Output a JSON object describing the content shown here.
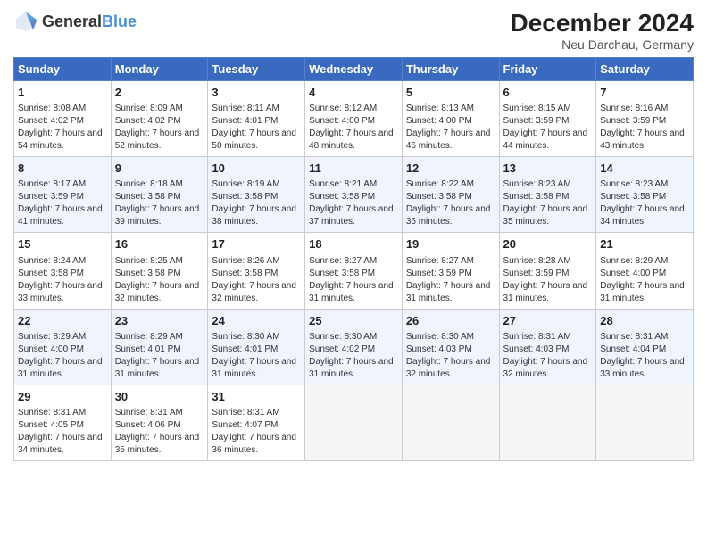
{
  "header": {
    "logo_general": "General",
    "logo_blue": "Blue",
    "title": "December 2024",
    "subtitle": "Neu Darchau, Germany"
  },
  "days_of_week": [
    "Sunday",
    "Monday",
    "Tuesday",
    "Wednesday",
    "Thursday",
    "Friday",
    "Saturday"
  ],
  "weeks": [
    [
      {
        "day": 1,
        "sunrise": "8:08 AM",
        "sunset": "4:02 PM",
        "daylight": "7 hours and 54 minutes."
      },
      {
        "day": 2,
        "sunrise": "8:09 AM",
        "sunset": "4:02 PM",
        "daylight": "7 hours and 52 minutes."
      },
      {
        "day": 3,
        "sunrise": "8:11 AM",
        "sunset": "4:01 PM",
        "daylight": "7 hours and 50 minutes."
      },
      {
        "day": 4,
        "sunrise": "8:12 AM",
        "sunset": "4:00 PM",
        "daylight": "7 hours and 48 minutes."
      },
      {
        "day": 5,
        "sunrise": "8:13 AM",
        "sunset": "4:00 PM",
        "daylight": "7 hours and 46 minutes."
      },
      {
        "day": 6,
        "sunrise": "8:15 AM",
        "sunset": "3:59 PM",
        "daylight": "7 hours and 44 minutes."
      },
      {
        "day": 7,
        "sunrise": "8:16 AM",
        "sunset": "3:59 PM",
        "daylight": "7 hours and 43 minutes."
      }
    ],
    [
      {
        "day": 8,
        "sunrise": "8:17 AM",
        "sunset": "3:59 PM",
        "daylight": "7 hours and 41 minutes."
      },
      {
        "day": 9,
        "sunrise": "8:18 AM",
        "sunset": "3:58 PM",
        "daylight": "7 hours and 39 minutes."
      },
      {
        "day": 10,
        "sunrise": "8:19 AM",
        "sunset": "3:58 PM",
        "daylight": "7 hours and 38 minutes."
      },
      {
        "day": 11,
        "sunrise": "8:21 AM",
        "sunset": "3:58 PM",
        "daylight": "7 hours and 37 minutes."
      },
      {
        "day": 12,
        "sunrise": "8:22 AM",
        "sunset": "3:58 PM",
        "daylight": "7 hours and 36 minutes."
      },
      {
        "day": 13,
        "sunrise": "8:23 AM",
        "sunset": "3:58 PM",
        "daylight": "7 hours and 35 minutes."
      },
      {
        "day": 14,
        "sunrise": "8:23 AM",
        "sunset": "3:58 PM",
        "daylight": "7 hours and 34 minutes."
      }
    ],
    [
      {
        "day": 15,
        "sunrise": "8:24 AM",
        "sunset": "3:58 PM",
        "daylight": "7 hours and 33 minutes."
      },
      {
        "day": 16,
        "sunrise": "8:25 AM",
        "sunset": "3:58 PM",
        "daylight": "7 hours and 32 minutes."
      },
      {
        "day": 17,
        "sunrise": "8:26 AM",
        "sunset": "3:58 PM",
        "daylight": "7 hours and 32 minutes."
      },
      {
        "day": 18,
        "sunrise": "8:27 AM",
        "sunset": "3:58 PM",
        "daylight": "7 hours and 31 minutes."
      },
      {
        "day": 19,
        "sunrise": "8:27 AM",
        "sunset": "3:59 PM",
        "daylight": "7 hours and 31 minutes."
      },
      {
        "day": 20,
        "sunrise": "8:28 AM",
        "sunset": "3:59 PM",
        "daylight": "7 hours and 31 minutes."
      },
      {
        "day": 21,
        "sunrise": "8:29 AM",
        "sunset": "4:00 PM",
        "daylight": "7 hours and 31 minutes."
      }
    ],
    [
      {
        "day": 22,
        "sunrise": "8:29 AM",
        "sunset": "4:00 PM",
        "daylight": "7 hours and 31 minutes."
      },
      {
        "day": 23,
        "sunrise": "8:29 AM",
        "sunset": "4:01 PM",
        "daylight": "7 hours and 31 minutes."
      },
      {
        "day": 24,
        "sunrise": "8:30 AM",
        "sunset": "4:01 PM",
        "daylight": "7 hours and 31 minutes."
      },
      {
        "day": 25,
        "sunrise": "8:30 AM",
        "sunset": "4:02 PM",
        "daylight": "7 hours and 31 minutes."
      },
      {
        "day": 26,
        "sunrise": "8:30 AM",
        "sunset": "4:03 PM",
        "daylight": "7 hours and 32 minutes."
      },
      {
        "day": 27,
        "sunrise": "8:31 AM",
        "sunset": "4:03 PM",
        "daylight": "7 hours and 32 minutes."
      },
      {
        "day": 28,
        "sunrise": "8:31 AM",
        "sunset": "4:04 PM",
        "daylight": "7 hours and 33 minutes."
      }
    ],
    [
      {
        "day": 29,
        "sunrise": "8:31 AM",
        "sunset": "4:05 PM",
        "daylight": "7 hours and 34 minutes."
      },
      {
        "day": 30,
        "sunrise": "8:31 AM",
        "sunset": "4:06 PM",
        "daylight": "7 hours and 35 minutes."
      },
      {
        "day": 31,
        "sunrise": "8:31 AM",
        "sunset": "4:07 PM",
        "daylight": "7 hours and 36 minutes."
      },
      null,
      null,
      null,
      null
    ]
  ]
}
